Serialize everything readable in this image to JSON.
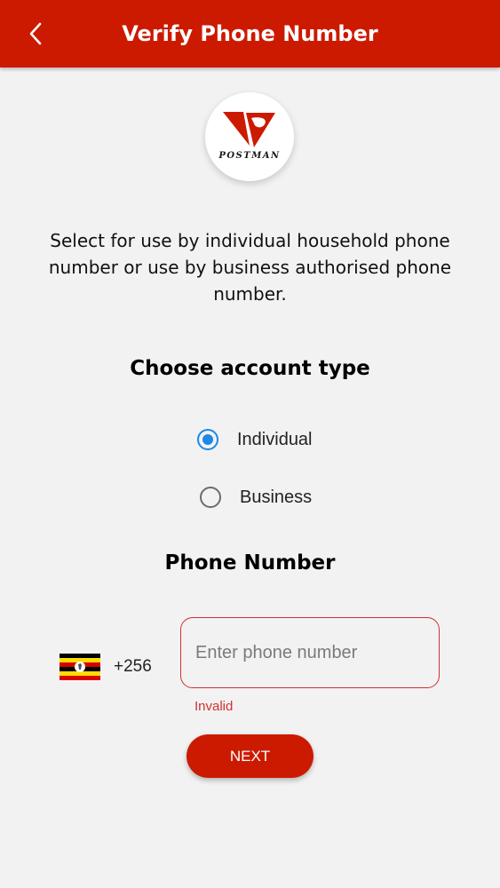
{
  "appbar": {
    "title": "Verify Phone Number",
    "back_icon": "chevron-left-icon",
    "color": "#cc1a00"
  },
  "logo": {
    "text": "POSTMAN",
    "color": "#cc1a00"
  },
  "description": "Select for use by individual household phone number or use by business authorised phone number.",
  "account_type": {
    "title": "Choose account type",
    "options": [
      {
        "label": "Individual",
        "selected": true
      },
      {
        "label": "Business",
        "selected": false
      }
    ]
  },
  "phone": {
    "title": "Phone Number",
    "flag_icon": "uganda-flag-icon",
    "country_code": "+256",
    "value": "",
    "placeholder": "Enter phone number",
    "error": "Invalid"
  },
  "next_label": "NEXT",
  "colors": {
    "accent": "#cc1a00",
    "radio_selected": "#1e88e5",
    "error": "#d32f2f",
    "background": "#f2f2f2"
  }
}
